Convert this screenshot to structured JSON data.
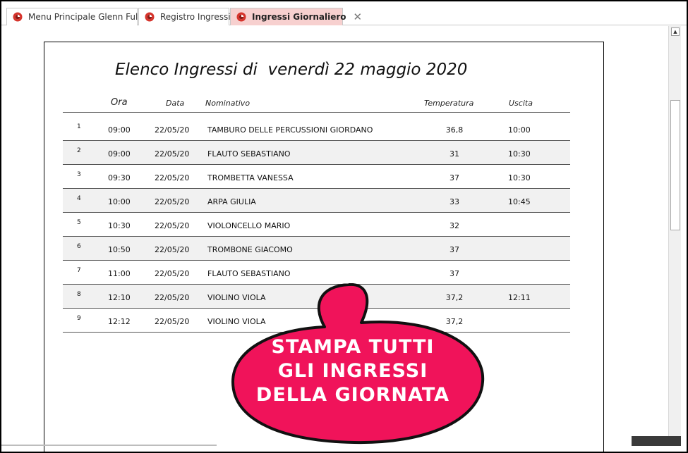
{
  "tabs": [
    {
      "label": "Menu Principale Glenn Full",
      "active": false
    },
    {
      "label": "Registro Ingressi",
      "active": false
    },
    {
      "label": "Ingressi Giornaliero",
      "active": true,
      "close_glyph": "✕"
    }
  ],
  "report": {
    "title": "Elenco Ingressi di  venerdì 22 maggio 2020",
    "columns": {
      "ora": "Ora",
      "data": "Data",
      "nominativo": "Nominativo",
      "temperatura": "Temperatura",
      "uscita": "Uscita"
    },
    "rows": [
      {
        "num": "1",
        "ora": "09:00",
        "data": "22/05/20",
        "nominativo": "TAMBURO DELLE PERCUSSIONI GIORDANO",
        "temperatura": "36,8",
        "uscita": "10:00"
      },
      {
        "num": "2",
        "ora": "09:00",
        "data": "22/05/20",
        "nominativo": "FLAUTO SEBASTIANO",
        "temperatura": "31",
        "uscita": "10:30"
      },
      {
        "num": "3",
        "ora": "09:30",
        "data": "22/05/20",
        "nominativo": "TROMBETTA VANESSA",
        "temperatura": "37",
        "uscita": "10:30"
      },
      {
        "num": "4",
        "ora": "10:00",
        "data": "22/05/20",
        "nominativo": "ARPA GIULIA",
        "temperatura": "33",
        "uscita": "10:45"
      },
      {
        "num": "5",
        "ora": "10:30",
        "data": "22/05/20",
        "nominativo": "VIOLONCELLO MARIO",
        "temperatura": "32",
        "uscita": ""
      },
      {
        "num": "6",
        "ora": "10:50",
        "data": "22/05/20",
        "nominativo": "TROMBONE GIACOMO",
        "temperatura": "37",
        "uscita": ""
      },
      {
        "num": "7",
        "ora": "11:00",
        "data": "22/05/20",
        "nominativo": "FLAUTO SEBASTIANO",
        "temperatura": "37",
        "uscita": ""
      },
      {
        "num": "8",
        "ora": "12:10",
        "data": "22/05/20",
        "nominativo": "VIOLINO VIOLA",
        "temperatura": "37,2",
        "uscita": "12:11"
      },
      {
        "num": "9",
        "ora": "12:12",
        "data": "22/05/20",
        "nominativo": "VIOLINO VIOLA",
        "temperatura": "37,2",
        "uscita": ""
      }
    ]
  },
  "callout": {
    "lines": [
      "STAMPA TUTTI",
      "GLI INGRESSI",
      "DELLA GIORNATA"
    ],
    "fill_color": "#f0135a",
    "text_color": "#ffffff"
  },
  "icons": {
    "tab_icon": "app-logo-icon",
    "scroll_up": "scroll-up-arrow-icon"
  },
  "colors": {
    "active_tab": "#f7d0cf",
    "alt_row": "#f1f1f1"
  }
}
